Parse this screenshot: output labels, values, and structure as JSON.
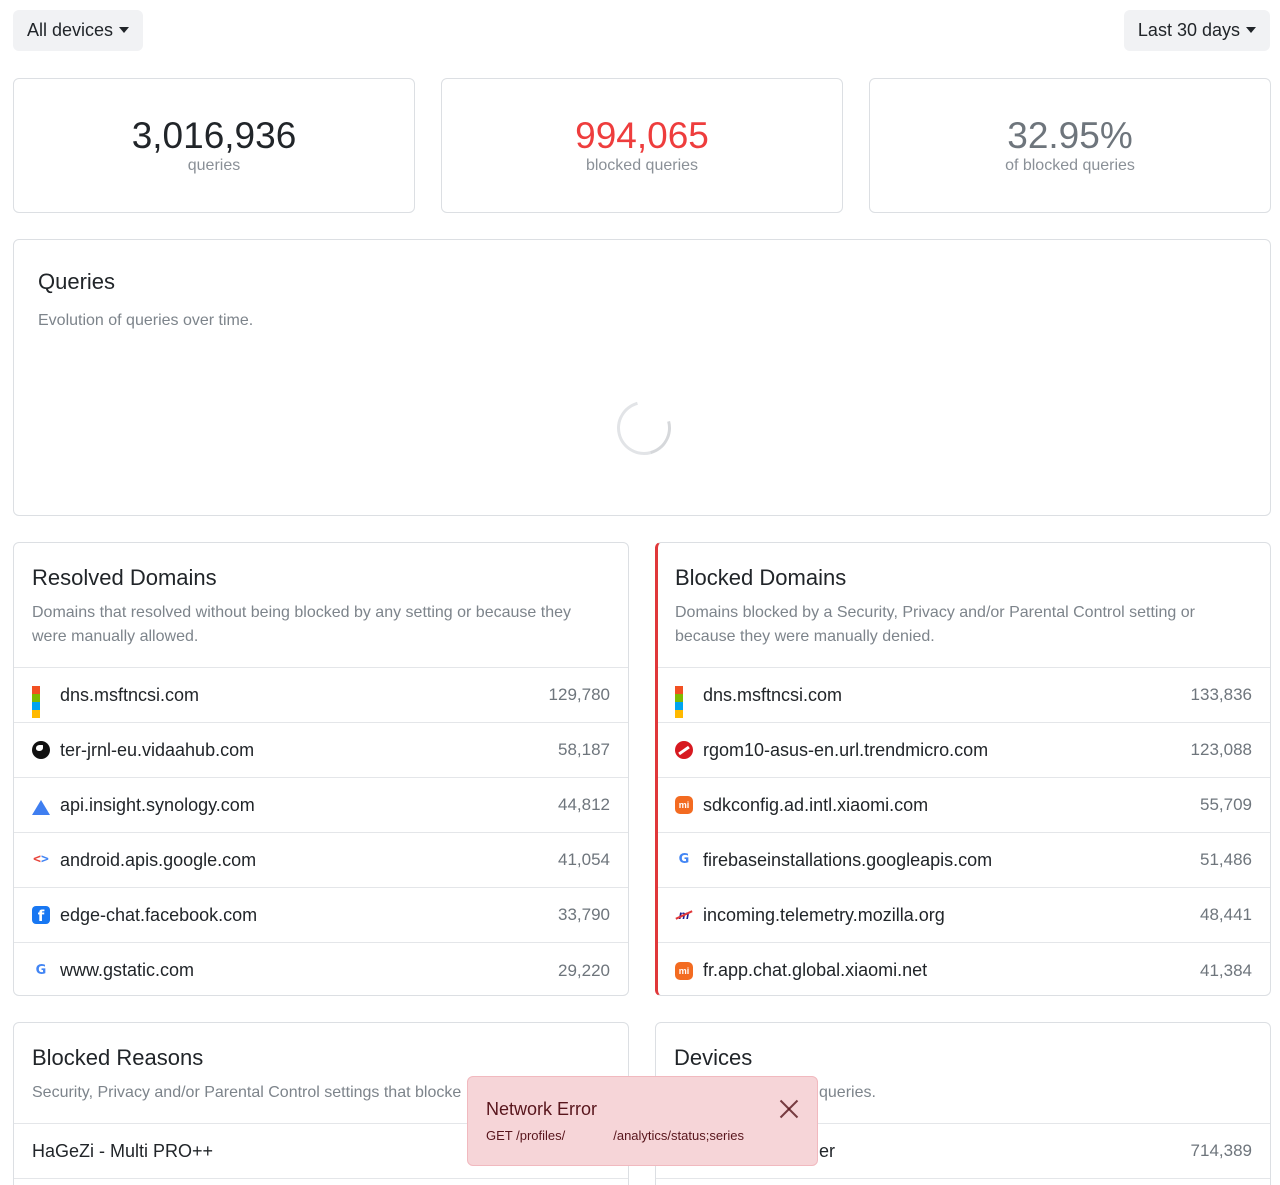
{
  "filters": {
    "devices_label": "All devices",
    "range_label": "Last 30 days"
  },
  "stats": {
    "queries": {
      "value": "3,016,936",
      "label": "queries"
    },
    "blocked": {
      "value": "994,065",
      "label": "blocked queries"
    },
    "ratio": {
      "value": "32.95%",
      "label": "of blocked queries"
    }
  },
  "queries_card": {
    "title": "Queries",
    "subtitle": "Evolution of queries over time."
  },
  "resolved": {
    "title": "Resolved Domains",
    "subtitle": "Domains that resolved without being blocked by any setting or because they were manually allowed.",
    "items": [
      {
        "domain": "dns.msftncsi.com",
        "count": "129,780",
        "icon": "microsoft-icon"
      },
      {
        "domain": "ter-jrnl-eu.vidaahub.com",
        "count": "58,187",
        "icon": "globe-icon"
      },
      {
        "domain": "api.insight.synology.com",
        "count": "44,812",
        "icon": "synology-icon"
      },
      {
        "domain": "android.apis.google.com",
        "count": "41,054",
        "icon": "google-developers-icon"
      },
      {
        "domain": "edge-chat.facebook.com",
        "count": "33,790",
        "icon": "facebook-icon"
      },
      {
        "domain": "www.gstatic.com",
        "count": "29,220",
        "icon": "google-icon"
      }
    ]
  },
  "blocked": {
    "title": "Blocked Domains",
    "subtitle": "Domains blocked by a Security, Privacy and/or Parental Control setting or because they were manually denied.",
    "items": [
      {
        "domain": "dns.msftncsi.com",
        "count": "133,836",
        "icon": "microsoft-icon"
      },
      {
        "domain": "rgom10-asus-en.url.trendmicro.com",
        "count": "123,088",
        "icon": "trendmicro-icon"
      },
      {
        "domain": "sdkconfig.ad.intl.xiaomi.com",
        "count": "55,709",
        "icon": "xiaomi-icon"
      },
      {
        "domain": "firebaseinstallations.googleapis.com",
        "count": "51,486",
        "icon": "google-icon"
      },
      {
        "domain": "incoming.telemetry.mozilla.org",
        "count": "48,441",
        "icon": "mozilla-icon"
      },
      {
        "domain": "fr.app.chat.global.xiaomi.net",
        "count": "41,384",
        "icon": "xiaomi-icon"
      }
    ]
  },
  "reasons": {
    "title": "Blocked Reasons",
    "subtitle": "Security, Privacy and/or Parental Control settings that blocke",
    "items": [
      {
        "name": "HaGeZi - Multi PRO++",
        "count": ""
      }
    ]
  },
  "devices": {
    "title": "Devices",
    "subtitle": "queries.",
    "items": [
      {
        "name": "er",
        "count": "714,389"
      }
    ]
  },
  "toast": {
    "title": "Network Error",
    "body_prefix": "GET /profiles/",
    "body_suffix": "/analytics/status;series"
  },
  "colors": {
    "blocked_accent": "#ee3d3d",
    "toast_bg": "#f6d5d8"
  }
}
